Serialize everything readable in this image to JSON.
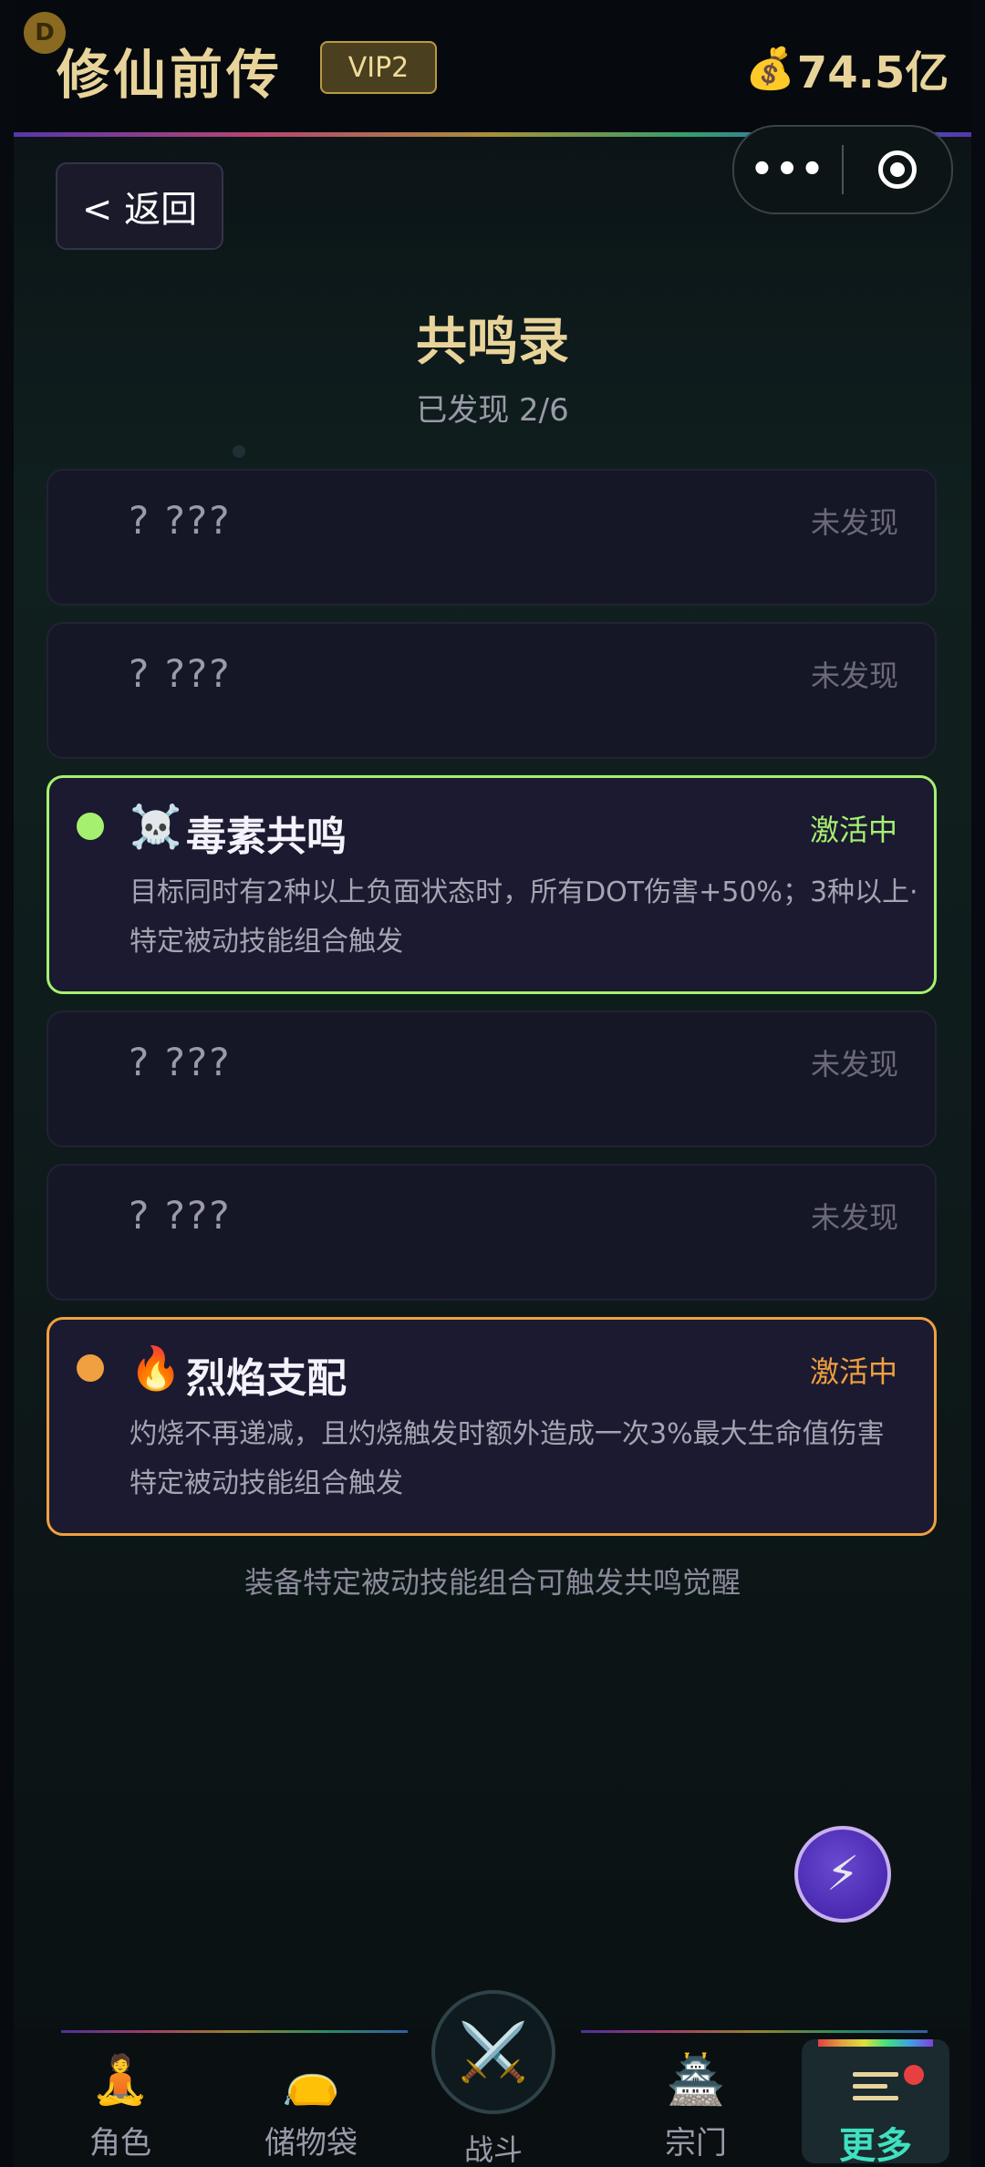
{
  "header": {
    "avatar_letter": "D",
    "app_title": "修仙前传",
    "vip": "VIP2",
    "gold_icon": "💰",
    "gold_amount": "74.5亿"
  },
  "capsule": {
    "more_label": "•••"
  },
  "back_label": "< 返回",
  "page": {
    "title": "共鸣录",
    "subtitle": "已发现 2/6"
  },
  "cards": [
    {
      "name": "? ???",
      "status": "未发现"
    },
    {
      "name": "? ???",
      "status": "未发现"
    },
    {
      "emoji": "☠️",
      "name": "毒素共鸣",
      "status": "激活中",
      "desc": "目标同时有2种以上负面状态时，所有DOT伤害+50%；3种以上·",
      "trigger": "特定被动技能组合触发",
      "accent": "#a6f070"
    },
    {
      "name": "? ???",
      "status": "未发现"
    },
    {
      "name": "? ???",
      "status": "未发现"
    },
    {
      "emoji": "🔥",
      "name": "烈焰支配",
      "status": "激活中",
      "desc": "灼烧不再递减，且灼烧触发时额外造成一次3%最大生命值伤害",
      "trigger": "特定被动技能组合触发",
      "accent": "#f0a040"
    }
  ],
  "hint": "装备特定被动技能组合可触发共鸣觉醒",
  "fab_icon": "⚡",
  "tabs": [
    {
      "icon": "🧘",
      "label": "角色"
    },
    {
      "icon": "👝",
      "label": "储物袋"
    },
    {
      "icon": "⚔️",
      "label": "战斗"
    },
    {
      "icon": "🏯",
      "label": "宗门"
    },
    {
      "label": "更多"
    }
  ]
}
